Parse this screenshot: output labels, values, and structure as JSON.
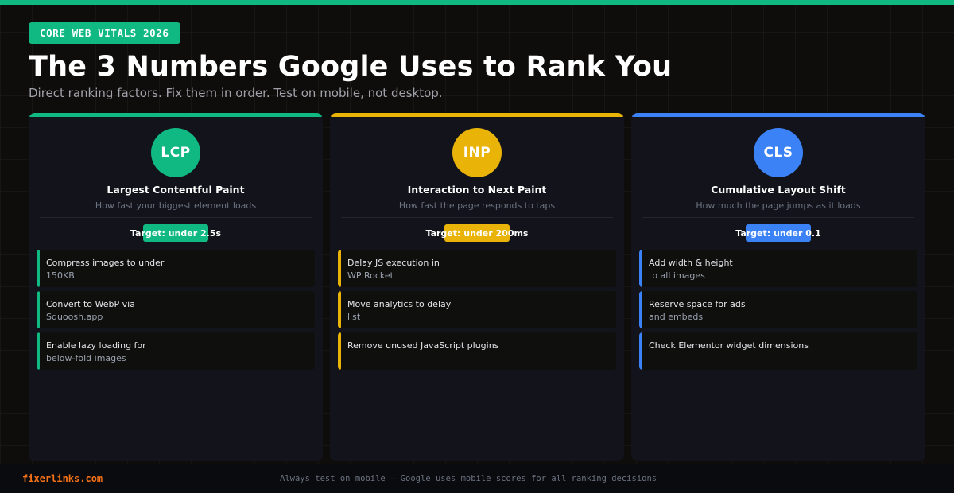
{
  "badge": "CORE WEB VITALS 2026",
  "title": "The 3 Numbers Google Uses to Rank You",
  "subtitle": "Direct ranking factors. Fix them in order. Test on mobile, not desktop.",
  "colors": {
    "green": "#10b981",
    "yellow": "#eab308",
    "blue": "#3b82f6",
    "orange": "#f97316"
  },
  "cards": [
    {
      "abbr": "LCP",
      "name": "Largest Contentful Paint",
      "desc": "How fast your biggest element loads",
      "target": "Target: under 2.5s",
      "tips": [
        {
          "line1": "Compress images to under",
          "line2": "150KB"
        },
        {
          "line1": "Convert to WebP via",
          "line2": "Squoosh.app"
        },
        {
          "line1": "Enable lazy loading for",
          "line2": "below-fold images"
        }
      ]
    },
    {
      "abbr": "INP",
      "name": "Interaction to Next Paint",
      "desc": "How fast the page responds to taps",
      "target": "Target: under 200ms",
      "tips": [
        {
          "line1": "Delay JS execution in",
          "line2": "WP Rocket"
        },
        {
          "line1": "Move analytics to delay",
          "line2": "list"
        },
        {
          "line1": "Remove unused JavaScript plugins",
          "line2": ""
        }
      ]
    },
    {
      "abbr": "CLS",
      "name": "Cumulative Layout Shift",
      "desc": "How much the page jumps as it loads",
      "target": "Target: under 0.1",
      "tips": [
        {
          "line1": "Add width & height",
          "line2": "to all images"
        },
        {
          "line1": "Reserve space for ads",
          "line2": "and embeds"
        },
        {
          "line1": "Check Elementor widget dimensions",
          "line2": ""
        }
      ]
    }
  ],
  "footer": {
    "brand": "fixerlinks.com",
    "note": "Always test on mobile — Google uses mobile scores for all ranking decisions"
  }
}
